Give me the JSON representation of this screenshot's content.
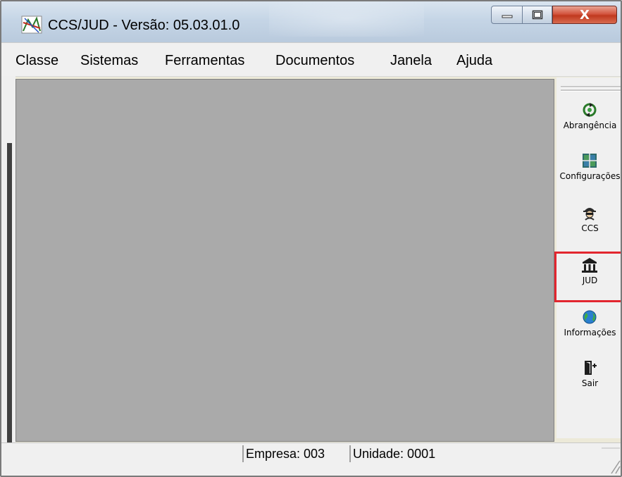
{
  "window": {
    "title": "CCS/JUD - Versão: 05.03.01.0",
    "controls": {
      "minimize_icon": "minimize-icon",
      "maximize_icon": "maximize-icon",
      "close_label": "X"
    }
  },
  "menu": {
    "items": [
      {
        "label": "Classe"
      },
      {
        "label": "Sistemas"
      },
      {
        "label": "Ferramentas"
      },
      {
        "label": "Documentos"
      },
      {
        "label": "Janela"
      },
      {
        "label": "Ajuda"
      }
    ]
  },
  "toolbar": {
    "buttons": [
      {
        "label": "Abrangência",
        "icon": "recycle-icon"
      },
      {
        "label": "Configurações",
        "icon": "grid-icon"
      },
      {
        "label": "CCS",
        "icon": "spy-icon"
      },
      {
        "label": "JUD",
        "icon": "courthouse-icon",
        "highlighted": true
      },
      {
        "label": "Informações",
        "icon": "globe-icon"
      },
      {
        "label": "Sair",
        "icon": "exit-door-icon"
      }
    ]
  },
  "status": {
    "empresa": "Empresa: 003",
    "unidade": "Unidade: 0001"
  },
  "colors": {
    "workspace": "#aaaaaa",
    "highlight": "#e2262f",
    "close_button": "#c0391f"
  }
}
